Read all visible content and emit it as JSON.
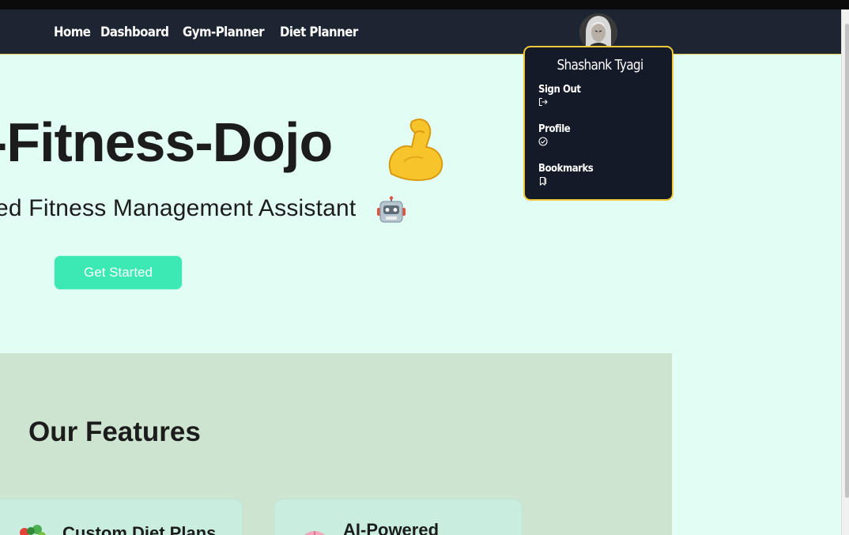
{
  "navbar": {
    "links": [
      {
        "label": "Home"
      },
      {
        "label": "Dashboard"
      },
      {
        "label": "Gym-Planner"
      },
      {
        "label": "Diet Planner"
      }
    ]
  },
  "user_menu": {
    "name": "Shashank Tyagi",
    "items": [
      {
        "label": "Sign Out",
        "icon": "sign-out-icon"
      },
      {
        "label": "Profile",
        "icon": "check-circle-icon"
      },
      {
        "label": "Bookmarks",
        "icon": "bookmark-icon"
      }
    ]
  },
  "hero": {
    "title": "-Fitness-Dojo",
    "title_emoji": "flexed-biceps-icon",
    "subtitle": "ed Fitness Management Assistant",
    "subtitle_emoji": "robot-icon",
    "cta_label": "Get Started"
  },
  "features": {
    "title": "Our Features",
    "cards": [
      {
        "title": "Custom Diet Plans",
        "icon": "salad-icon"
      },
      {
        "title": "AI-Powered",
        "icon": "brain-icon"
      }
    ]
  },
  "colors": {
    "navbar_bg": "#1e2532",
    "page_bg": "#e2fdf3",
    "accent": "#3ce9b4",
    "dropdown_border": "#f0c93a",
    "features_bg": "#cde5d0"
  }
}
